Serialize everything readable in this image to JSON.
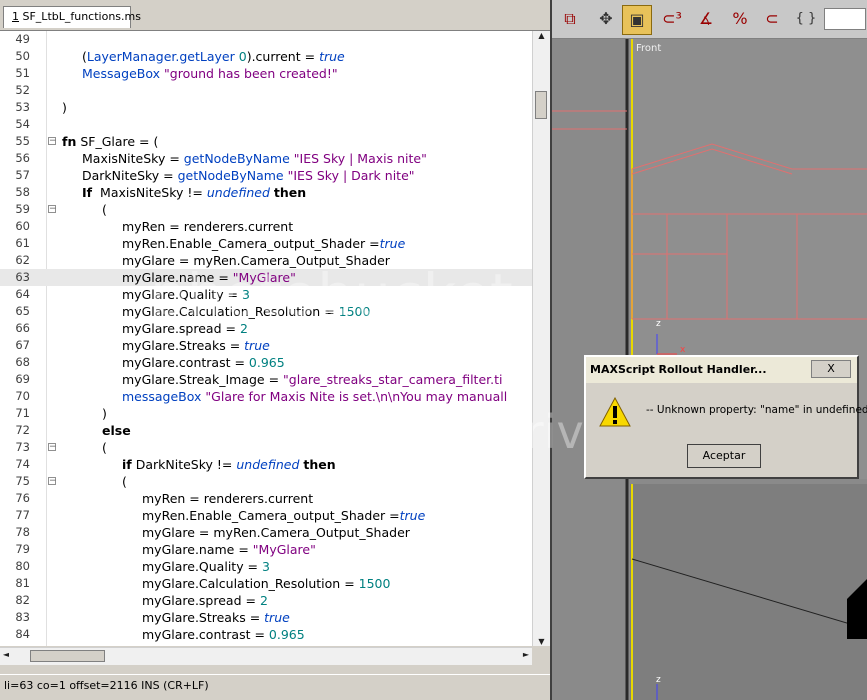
{
  "editor": {
    "tab_label": "SF_LtbL_functions.ms",
    "tab_index": "1",
    "status": "li=63 co=1 offset=2116 INS (CR+LF)"
  },
  "code_lines": [
    {
      "n": "49",
      "indent": 0,
      "fold": "",
      "text": ""
    },
    {
      "n": "50",
      "indent": 1,
      "fold": "",
      "text": "(LayerManager.getLayer 0).current = true"
    },
    {
      "n": "51",
      "indent": 1,
      "fold": "",
      "text": "MessageBox \"ground has been created!\""
    },
    {
      "n": "52",
      "indent": 0,
      "fold": "",
      "text": ""
    },
    {
      "n": "53",
      "indent": 0,
      "fold": "",
      "text": ")"
    },
    {
      "n": "54",
      "indent": 0,
      "fold": "",
      "text": ""
    },
    {
      "n": "55",
      "indent": 0,
      "fold": "-",
      "text": "fn SF_Glare = ("
    },
    {
      "n": "56",
      "indent": 1,
      "fold": "",
      "text": "MaxisNiteSky = getNodeByName \"IES Sky | Maxis nite\""
    },
    {
      "n": "57",
      "indent": 1,
      "fold": "",
      "text": "DarkNiteSky = getNodeByName \"IES Sky | Dark nite\""
    },
    {
      "n": "58",
      "indent": 1,
      "fold": "",
      "text": "If  MaxisNiteSky != undefined then"
    },
    {
      "n": "59",
      "indent": 2,
      "fold": "-",
      "text": "("
    },
    {
      "n": "60",
      "indent": 3,
      "fold": "",
      "text": "myRen = renderers.current"
    },
    {
      "n": "61",
      "indent": 3,
      "fold": "",
      "text": "myRen.Enable_Camera_output_Shader =true"
    },
    {
      "n": "62",
      "indent": 3,
      "fold": "",
      "text": "myGlare = myRen.Camera_Output_Shader"
    },
    {
      "n": "63",
      "indent": 3,
      "fold": "",
      "text": "myGlare.name = \"MyGlare\""
    },
    {
      "n": "64",
      "indent": 3,
      "fold": "",
      "text": "myGlare.Quality = 3"
    },
    {
      "n": "65",
      "indent": 3,
      "fold": "",
      "text": "myGlare.Calculation_Resolution = 1500"
    },
    {
      "n": "66",
      "indent": 3,
      "fold": "",
      "text": "myGlare.spread = 2"
    },
    {
      "n": "67",
      "indent": 3,
      "fold": "",
      "text": "myGlare.Streaks = true"
    },
    {
      "n": "68",
      "indent": 3,
      "fold": "",
      "text": "myGlare.contrast = 0.965"
    },
    {
      "n": "69",
      "indent": 3,
      "fold": "",
      "text": "myGlare.Streak_Image = \"glare_streaks_star_camera_filter.ti"
    },
    {
      "n": "70",
      "indent": 3,
      "fold": "",
      "text": "messageBox \"Glare for Maxis Nite is set.\\n\\nYou may manuall"
    },
    {
      "n": "71",
      "indent": 2,
      "fold": "",
      "text": ")"
    },
    {
      "n": "72",
      "indent": 2,
      "fold": "",
      "text": "else"
    },
    {
      "n": "73",
      "indent": 2,
      "fold": "-",
      "text": "("
    },
    {
      "n": "74",
      "indent": 3,
      "fold": "",
      "text": "if DarkNiteSky != undefined then"
    },
    {
      "n": "75",
      "indent": 3,
      "fold": "-",
      "text": "("
    },
    {
      "n": "76",
      "indent": 4,
      "fold": "",
      "text": "myRen = renderers.current"
    },
    {
      "n": "77",
      "indent": 4,
      "fold": "",
      "text": "myRen.Enable_Camera_output_Shader =true"
    },
    {
      "n": "78",
      "indent": 4,
      "fold": "",
      "text": "myGlare = myRen.Camera_Output_Shader"
    },
    {
      "n": "79",
      "indent": 4,
      "fold": "",
      "text": "myGlare.name = \"MyGlare\""
    },
    {
      "n": "80",
      "indent": 4,
      "fold": "",
      "text": "myGlare.Quality = 3"
    },
    {
      "n": "81",
      "indent": 4,
      "fold": "",
      "text": "myGlare.Calculation_Resolution = 1500"
    },
    {
      "n": "82",
      "indent": 4,
      "fold": "",
      "text": "myGlare.spread = 2"
    },
    {
      "n": "83",
      "indent": 4,
      "fold": "",
      "text": "myGlare.Streaks = true"
    },
    {
      "n": "84",
      "indent": 4,
      "fold": "",
      "text": "myGlare.contrast = 0.965"
    }
  ],
  "viewport": {
    "label": "Front",
    "axis_z": "z",
    "axis_x": "x"
  },
  "toolbar": {
    "icons": [
      "snap-icon",
      "select-move-icon",
      "select-object-icon",
      "snap-3-icon",
      "angle-snap-icon",
      "percent-snap-icon",
      "spinner-snap-icon",
      "named-selection-icon",
      "abc-icon"
    ]
  },
  "dialog": {
    "title": "MAXScript Rollout Handler...",
    "close_label": "X",
    "message": "-- Unknown property: \"name\" in undefined",
    "ok_label": "Aceptar"
  },
  "watermark": {
    "line1": "photobucket",
    "line2": "Join free. Share privately."
  }
}
